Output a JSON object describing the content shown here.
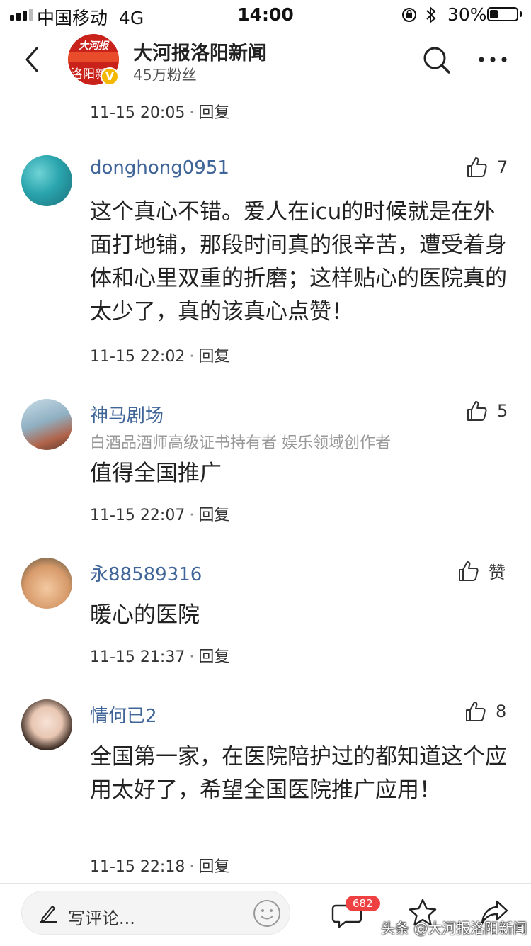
{
  "status_bar": {
    "carrier": "中国移动",
    "network": "4G",
    "time": "14:00",
    "battery": "30%",
    "battery_level": 0.3
  },
  "header": {
    "account_name": "大河报洛阳新闻",
    "followers": "45万粉丝",
    "logo_text_top": "大河报",
    "logo_text_bottom": "洛阳新"
  },
  "reply_label": "回复",
  "top_meta": {
    "time": "11-15 20:05"
  },
  "comments": [
    {
      "username": "donghong0951",
      "likes": "7",
      "text": "这个真心不错。爱人在icu的时候就是在外面打地铺，那段时间真的很辛苦，遭受着身体和心里双重的折磨；这样贴心的医院真的太少了，真的该真心点赞！",
      "time": "11-15 22:02"
    },
    {
      "username": "神马剧场",
      "tag": "白酒品酒师高级证书持有者 娱乐领域创作者",
      "likes": "5",
      "text": "值得全国推广",
      "time": "11-15 22:07"
    },
    {
      "username": "永88589316",
      "likes": "赞",
      "text": "暖心的医院",
      "time": "11-15 21:37"
    },
    {
      "username": "情何已2",
      "likes": "8",
      "text": "全国第一家，在医院陪护过的都知道这个应用太好了，希望全国医院推广应用！",
      "time": "11-15 22:18"
    }
  ],
  "bottom_bar": {
    "comment_placeholder": "写评论...",
    "comment_count": "682"
  },
  "watermark": "头条 @大河报洛阳新闻",
  "colors": {
    "username": "#406599",
    "badge": "#f04142",
    "verified": "#f5b800",
    "logo": "#c8221b"
  }
}
